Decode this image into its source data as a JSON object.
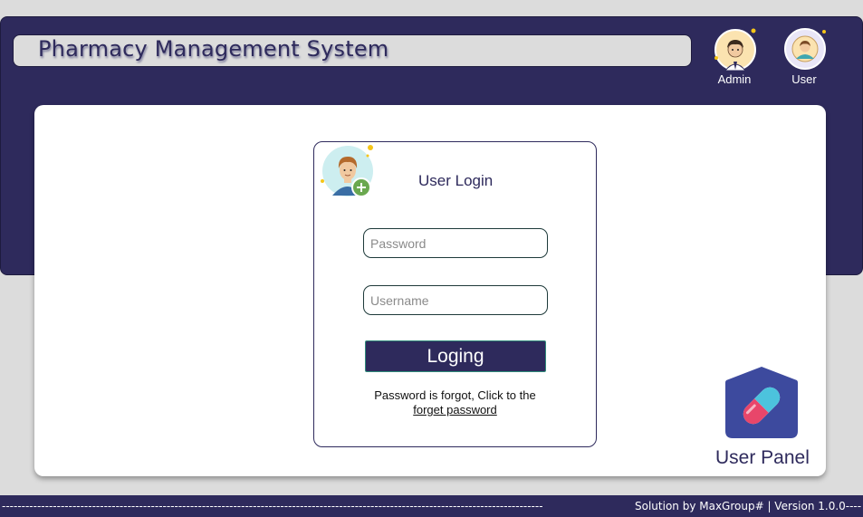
{
  "header": {
    "title": "Pharmacy Management System",
    "roles": [
      {
        "label": "Admin",
        "icon": "admin-avatar-icon"
      },
      {
        "label": "User",
        "icon": "user-avatar-icon"
      }
    ]
  },
  "login": {
    "title": "User Login",
    "avatar_icon": "user-add-avatar-icon",
    "password_placeholder": "Password",
    "username_placeholder": "Username",
    "button_label": "Loging",
    "forgot_text": "Password is forgot, Click to the",
    "forgot_link": "forget password"
  },
  "panel": {
    "label": "User Panel",
    "icon": "pill-capsule-icon"
  },
  "footer": {
    "dashes": "------------------------------------------------------------------------------------------------------------------------------------------",
    "credit": "Solution by MaxGroup# | Version 1.0.0----"
  },
  "colors": {
    "brand": "#2e2a5c",
    "background": "#dcdcdc",
    "card": "#ffffff"
  }
}
